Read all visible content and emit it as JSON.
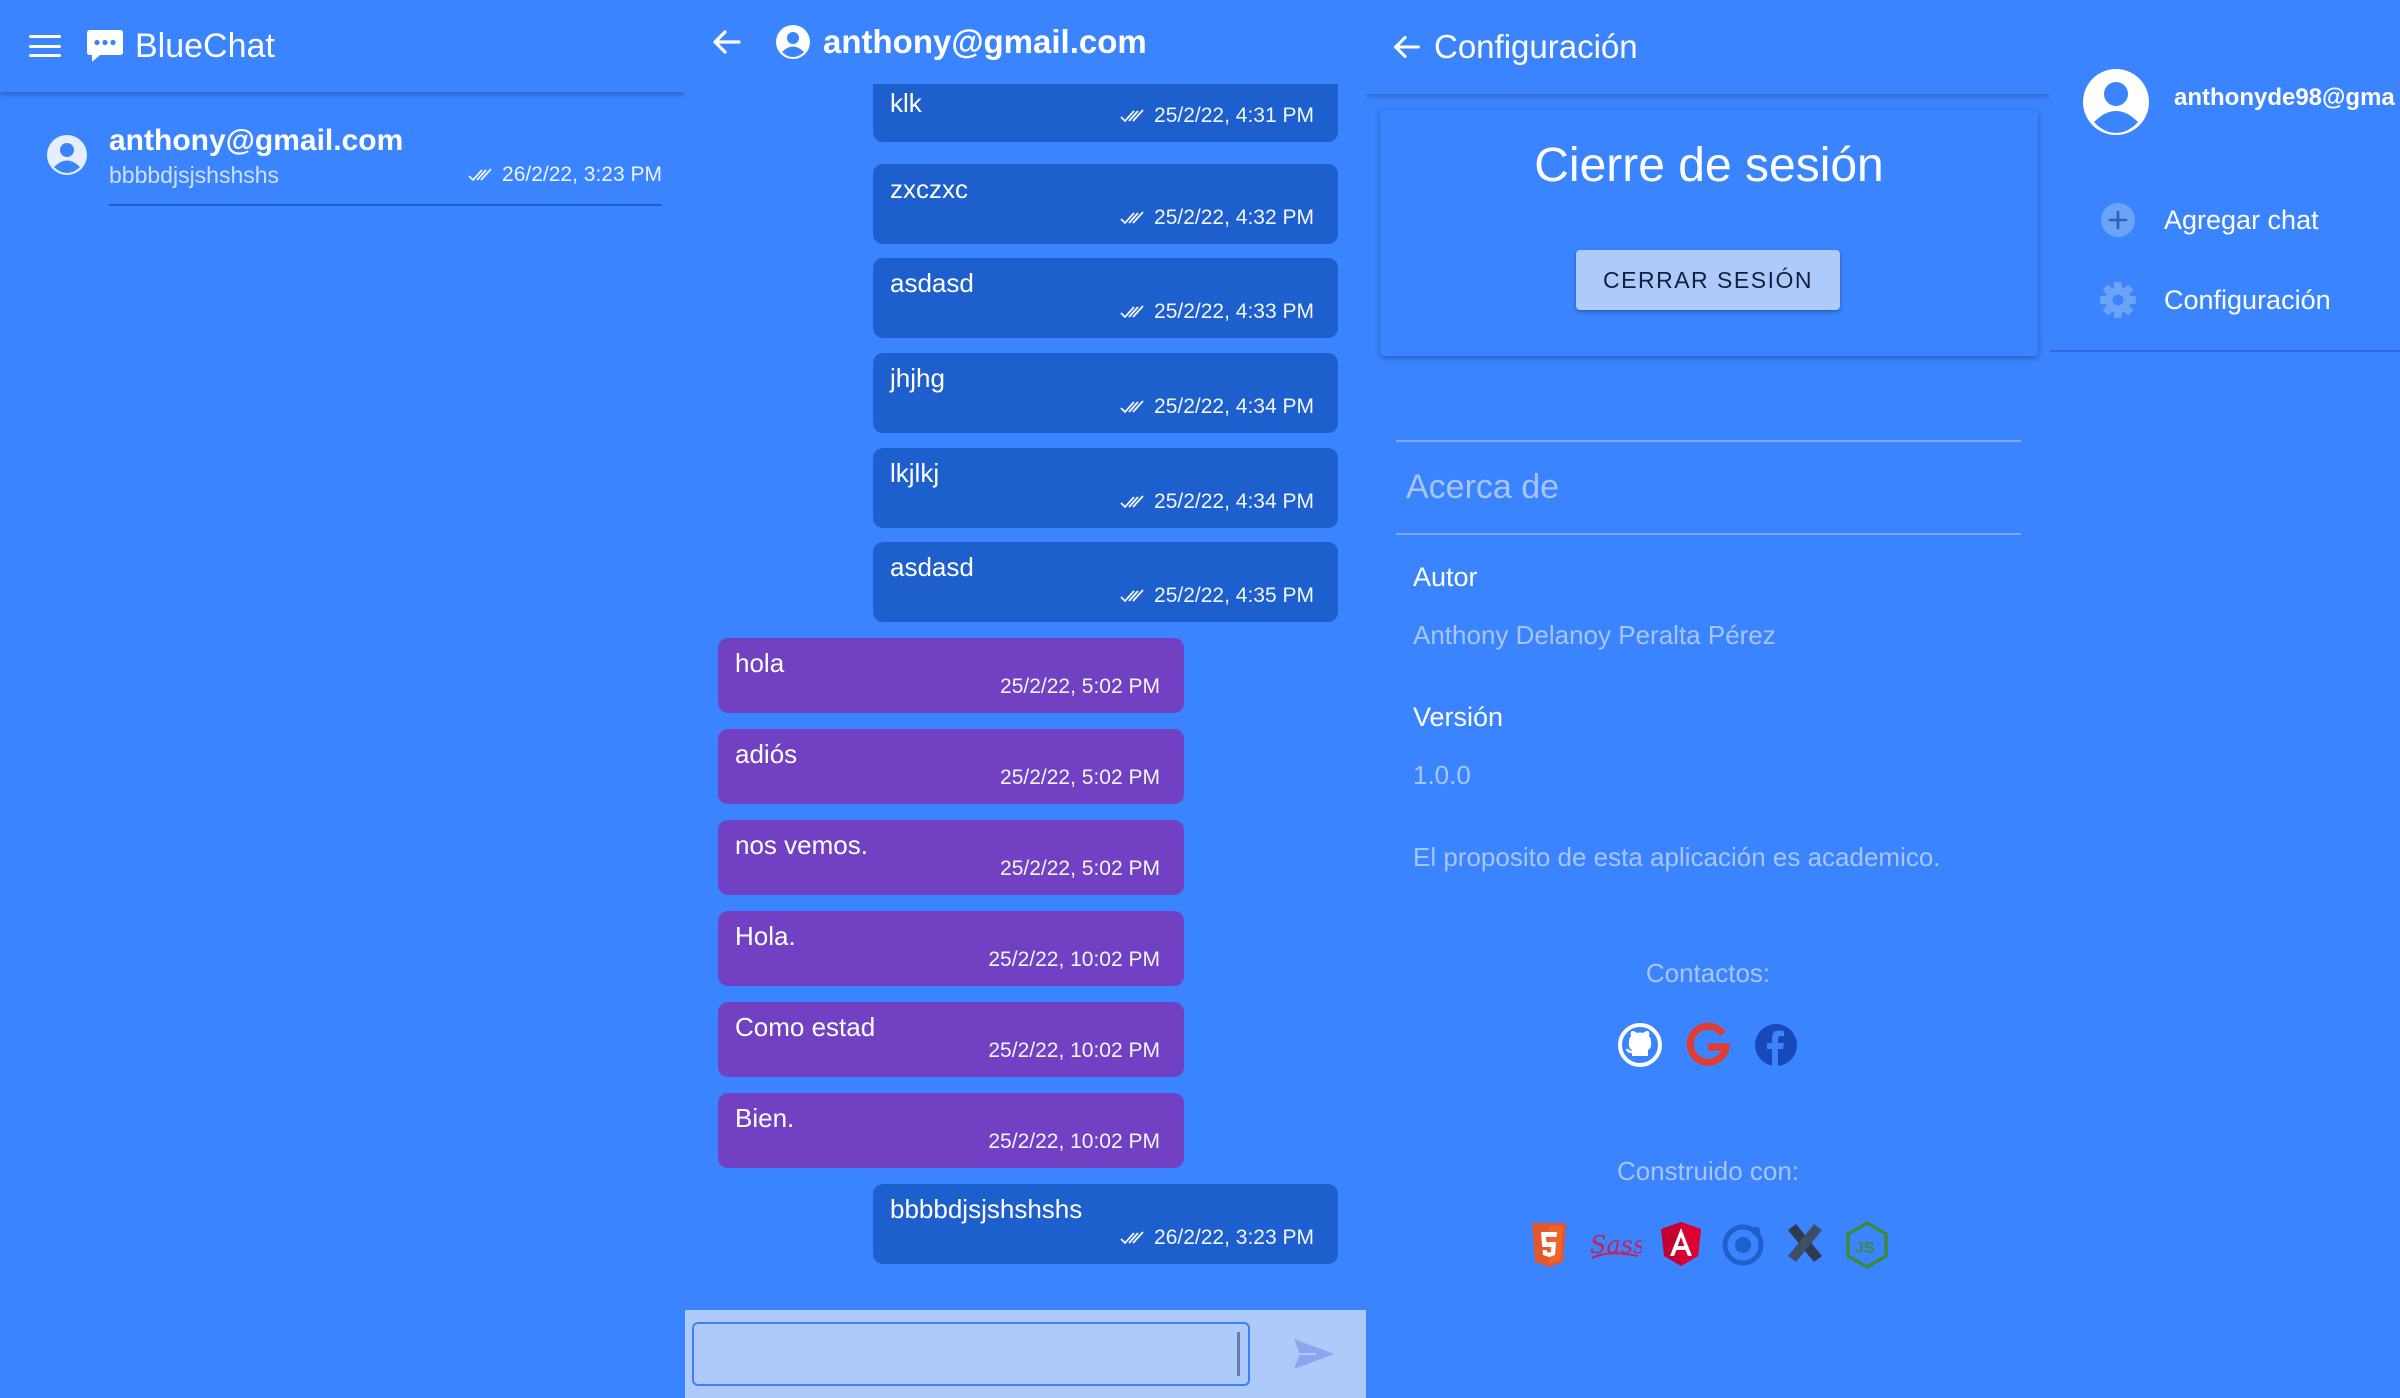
{
  "app": {
    "title": "BlueChat"
  },
  "chat_list": {
    "items": [
      {
        "name": "anthony@gmail.com",
        "last_message": "bbbbdjsjshshshs",
        "time": "26/2/22, 3:23 PM"
      }
    ]
  },
  "conversation": {
    "title": "anthony@gmail.com",
    "messages": [
      {
        "text": "klk",
        "time": "25/2/22, 4:31 PM",
        "direction": "out"
      },
      {
        "text": "zxczxc",
        "time": "25/2/22, 4:32 PM",
        "direction": "out"
      },
      {
        "text": "asdasd",
        "time": "25/2/22, 4:33 PM",
        "direction": "out"
      },
      {
        "text": "jhjhg",
        "time": "25/2/22, 4:34 PM",
        "direction": "out"
      },
      {
        "text": "lkjlkj",
        "time": "25/2/22, 4:34 PM",
        "direction": "out"
      },
      {
        "text": "asdasd",
        "time": "25/2/22, 4:35 PM",
        "direction": "out"
      },
      {
        "text": "hola",
        "time": "25/2/22, 5:02 PM",
        "direction": "in"
      },
      {
        "text": "adiós",
        "time": "25/2/22, 5:02 PM",
        "direction": "in"
      },
      {
        "text": "nos vemos.",
        "time": "25/2/22, 5:02 PM",
        "direction": "in"
      },
      {
        "text": "Hola.",
        "time": "25/2/22, 10:02 PM",
        "direction": "in"
      },
      {
        "text": "Como estad",
        "time": "25/2/22, 10:02 PM",
        "direction": "in"
      },
      {
        "text": "Bien.",
        "time": "25/2/22, 10:02 PM",
        "direction": "in"
      },
      {
        "text": "bbbbdjsjshshshs",
        "time": "26/2/22, 3:23 PM",
        "direction": "out"
      }
    ],
    "composer": {
      "value": ""
    }
  },
  "settings": {
    "title": "Configuración",
    "logout_title": "Cierre de sesión",
    "logout_button": "CERRAR SESIÓN",
    "about_heading": "Acerca de",
    "author_label": "Autor",
    "author_value": "Anthony Delanoy Peralta Pérez",
    "version_label": "Versión",
    "version_value": "1.0.0",
    "purpose": "El proposito de esta aplicación es academico.",
    "contacts_label": "Contactos:",
    "contacts": [
      "github-icon",
      "google-icon",
      "facebook-icon"
    ],
    "built_with_label": "Construido con:",
    "built_with": [
      "html5-icon",
      "sass-icon",
      "angular-icon",
      "ionic-icon",
      "capacitor-icon",
      "nodejs-icon"
    ]
  },
  "drawer": {
    "email": "anthonyde98@gma",
    "items": [
      {
        "label": "Agregar chat",
        "icon": "add-circle-icon"
      },
      {
        "label": "Configuración",
        "icon": "gear-icon"
      }
    ]
  },
  "colors": {
    "background": "#3a84ff",
    "outgoing_bubble": "#1e5fce",
    "incoming_bubble": "#7241c3",
    "muted_text": "#a9c5f7",
    "composer_bg": "#aecafa"
  }
}
